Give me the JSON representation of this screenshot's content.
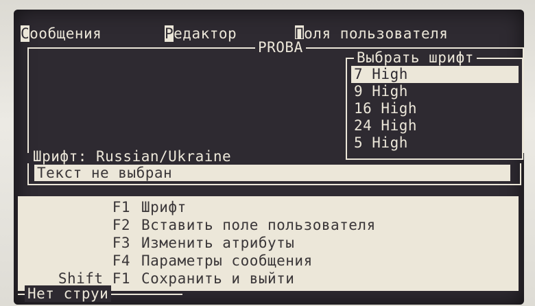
{
  "menu": {
    "items": [
      {
        "hotkey": "С",
        "rest": "ообщения"
      },
      {
        "hotkey": "Р",
        "rest": "едактор"
      },
      {
        "hotkey": "П",
        "rest": "оля пользователя"
      }
    ]
  },
  "message_frame": {
    "title": "PROBA"
  },
  "font_popup": {
    "title": "Выбрать шрифт",
    "options": [
      "7 High",
      "9 High",
      "16 High",
      "24 High",
      "5 High"
    ],
    "selected_index": 0
  },
  "font_status": "Шрифт: Russian/Ukraine",
  "text_input": {
    "value": "Текст не выбран"
  },
  "keys": [
    {
      "key": "F1",
      "action": "Шрифт"
    },
    {
      "key": "F2",
      "action": "Вставить поле пользователя"
    },
    {
      "key": "F3",
      "action": "Изменить атрибуты"
    },
    {
      "key": "F4",
      "action": "Параметры сообщения"
    },
    {
      "key": "Shift F1",
      "action": "Сохранить и выйти"
    }
  ],
  "status": "Нет струи",
  "colors": {
    "screen_bg": "#2e2a31",
    "phosphor": "#ece7d9"
  }
}
